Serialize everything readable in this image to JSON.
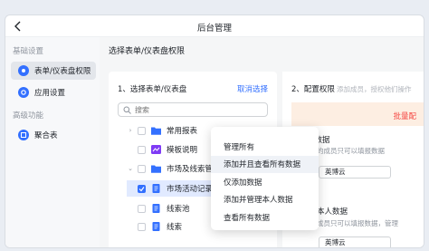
{
  "window": {
    "title": "后台管理"
  },
  "sidebar": {
    "section1": "基础设置",
    "items1": [
      {
        "label": "表单/仪表盘权限",
        "icon": "cloud-icon"
      },
      {
        "label": "应用设置",
        "icon": "gear-icon"
      }
    ],
    "section2": "高级功能",
    "items2": [
      {
        "label": "聚合表",
        "icon": "grid-icon"
      }
    ]
  },
  "main": {
    "header": "选择表单/仪表盘权限",
    "step1": {
      "title": "1、选择表单/仪表盘",
      "cancel": "取消选择",
      "search_placeholder": "搜索"
    },
    "tree": [
      {
        "label": "常用报表",
        "type": "folder",
        "checked": false
      },
      {
        "label": "模板说明",
        "type": "dashboard",
        "checked": false
      },
      {
        "label": "市场及线索管理",
        "type": "folder",
        "checked": false
      },
      {
        "label": "市场活动记录",
        "type": "form",
        "checked": true
      },
      {
        "label": "线索池",
        "type": "form",
        "checked": false
      },
      {
        "label": "线索",
        "type": "form",
        "checked": false
      }
    ],
    "step2": {
      "title": "2、配置权限",
      "hint": "添加成员，授权他们操作",
      "batch": "批量配",
      "perm1_label": "仅添加数据",
      "perm1_desc": "的成员只可以填报数据",
      "perm1_member": "英博云",
      "perm2_label": "本人数据",
      "perm2_desc": "成员只可以填报数据，管理",
      "perm2_member": "英博云"
    }
  },
  "dropdown": {
    "items": [
      "管理所有",
      "添加并且查看所有数据",
      "仅添加数据",
      "添加并管理本人数据",
      "查看所有数据"
    ],
    "hover_index": 1
  },
  "colors": {
    "accent": "#3370ff",
    "warn_bg": "#fdeee2",
    "warn_text": "#f54a45"
  }
}
